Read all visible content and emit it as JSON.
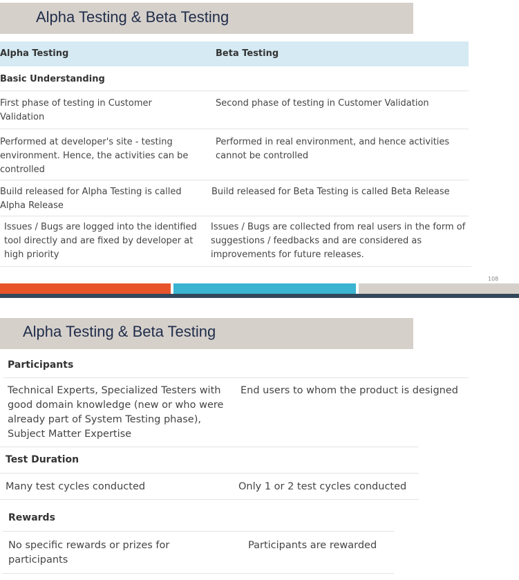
{
  "slide1": {
    "title": "Alpha Testing & Beta Testing",
    "header": {
      "alpha": "Alpha Testing",
      "beta": "Beta Testing"
    },
    "section_basic": "Basic Understanding",
    "rows": [
      {
        "alpha": "First phase of testing in Customer Validation",
        "beta": "Second phase of testing in Customer Validation"
      },
      {
        "alpha": "Performed at developer's site - testing environment. Hence, the activities can be controlled",
        "beta": "Performed in real environment, and hence activities cannot be controlled"
      },
      {
        "alpha": "Build released for Alpha Testing is called Alpha Release",
        "beta": "Build released for Beta Testing is called Beta Release"
      },
      {
        "alpha": "Issues / Bugs are logged into the identified tool directly and are fixed by developer at high priority",
        "beta": "Issues / Bugs are collected from real users in the form of suggestions / feedbacks and are considered as improvements for future releases."
      }
    ],
    "page_number": "108"
  },
  "slide2": {
    "title": "Alpha Testing & Beta Testing",
    "section_participants": "Participants",
    "participants": {
      "alpha": "Technical Experts, Specialized Testers with good domain knowledge (new or who were already part of System Testing phase), Subject Matter Expertise",
      "beta": "End users to whom the product is designed"
    },
    "section_duration": "Test Duration",
    "duration": {
      "alpha": "Many test cycles conducted",
      "beta": "Only 1 or 2 test cycles conducted"
    },
    "section_rewards": "Rewards",
    "rewards": {
      "alpha": "No specific rewards or prizes for participants",
      "beta": "Participants are rewarded"
    }
  },
  "colors": {
    "orange": "#e8542a",
    "blue": "#3ab4d0",
    "grey": "#d6d0cb",
    "navy": "#1f2d4a",
    "header_bg": "#d5eaf3"
  }
}
